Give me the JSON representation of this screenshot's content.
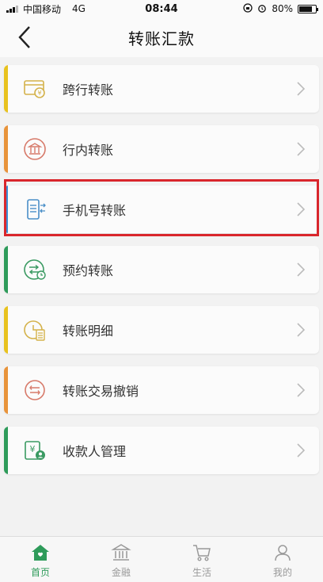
{
  "status_bar": {
    "carrier": "中国移动",
    "network": "4G",
    "time": "08:44",
    "battery": "80%",
    "battery_level": 0.8
  },
  "nav": {
    "title": "转账汇款",
    "back_icon": "chevron-left-icon"
  },
  "menu": {
    "items": [
      {
        "label": "跨行转账",
        "icon": "cross-bank-card-icon",
        "accent": "#e8c21e"
      },
      {
        "label": "行内转账",
        "icon": "bank-building-icon",
        "accent": "#e8933a"
      },
      {
        "label": "手机号转账",
        "icon": "phone-transfer-icon",
        "accent": "#3a8fd6"
      },
      {
        "label": "预约转账",
        "icon": "scheduled-transfer-icon",
        "accent": "#2e9b5a"
      },
      {
        "label": "转账明细",
        "icon": "transfer-details-icon",
        "accent": "#e8c21e"
      },
      {
        "label": "转账交易撤销",
        "icon": "undo-transfer-icon",
        "accent": "#e8933a"
      },
      {
        "label": "收款人管理",
        "icon": "payee-management-icon",
        "accent": "#2e9b5a"
      }
    ],
    "highlight_color": "#d9262c"
  },
  "tab_bar": {
    "items": [
      {
        "label": "首页",
        "icon": "home-icon",
        "active": true
      },
      {
        "label": "金融",
        "icon": "bank-icon",
        "active": false
      },
      {
        "label": "生活",
        "icon": "cart-icon",
        "active": false
      },
      {
        "label": "我的",
        "icon": "person-icon",
        "active": false
      }
    ],
    "active_color": "#2e9b5a"
  }
}
